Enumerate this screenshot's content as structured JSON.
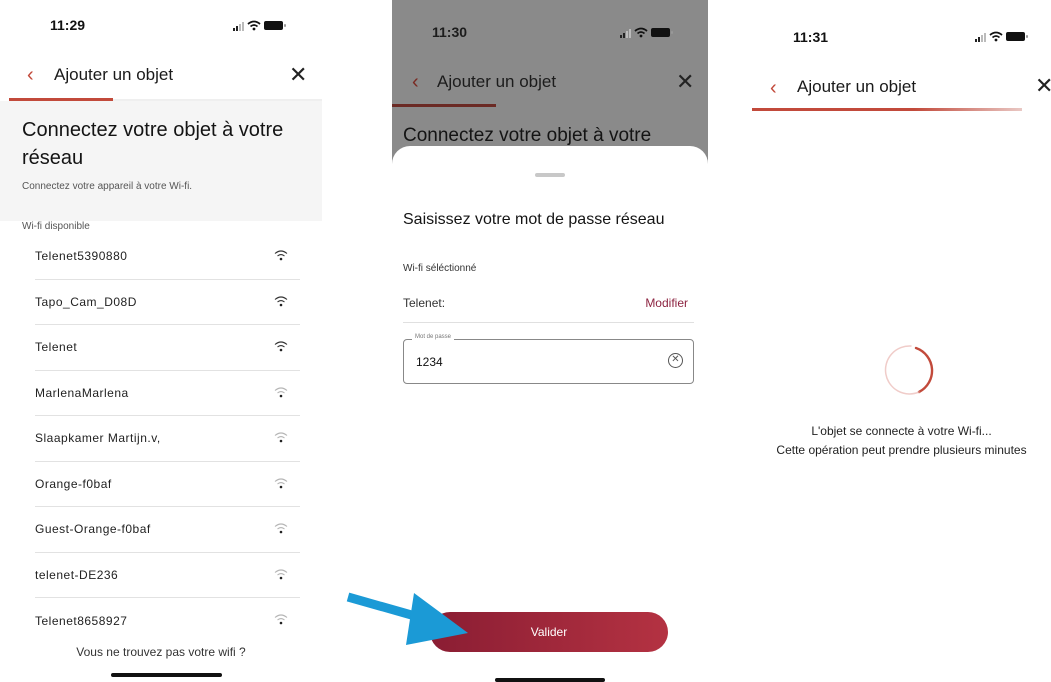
{
  "screen1": {
    "time": "11:29",
    "header_back": "‹",
    "header_title": "Ajouter un objet",
    "header_close": "✕",
    "heading_line1": "Connectez votre objet à votre",
    "heading_line2": "réseau",
    "subtitle": "Connectez votre appareil à votre Wi-fi.",
    "section_label": "Wi-fi disponible",
    "networks": [
      {
        "name": "Telenet5390880",
        "strength": "strong"
      },
      {
        "name": "Tapo_Cam_D08D",
        "strength": "strong"
      },
      {
        "name": "Telenet",
        "strength": "strong"
      },
      {
        "name": "MarlenaMarlena",
        "strength": "weak"
      },
      {
        "name": "Slaapkamer Martijn.v,",
        "strength": "weak"
      },
      {
        "name": "Orange-f0baf",
        "strength": "weak"
      },
      {
        "name": "Guest-Orange-f0baf",
        "strength": "weak"
      },
      {
        "name": "telenet-DE236",
        "strength": "weak"
      },
      {
        "name": "Telenet8658927",
        "strength": "weak"
      }
    ],
    "not_found": "Vous ne trouvez pas votre wifi ?"
  },
  "screen2": {
    "time": "11:30",
    "header_back": "‹",
    "header_title": "Ajouter un objet",
    "header_close": "✕",
    "behind_heading": "Connectez votre objet à votre",
    "sheet_title": "Saisissez votre mot de passe réseau",
    "selected_label": "Wi-fi séléctionné",
    "selected_network": "Telenet:",
    "modify_label": "Modifier",
    "password_legend": "Mot de passe",
    "password_value": "1234",
    "clear_icon": "✕",
    "submit_label": "Valider"
  },
  "screen3": {
    "time": "11:31",
    "header_back": "‹",
    "header_title": "Ajouter un objet",
    "header_close": "✕",
    "status_line1": "L'objet se connecte à votre Wi-fi...",
    "status_line2": "Cette opération peut prendre plusieurs minutes"
  },
  "colors": {
    "accent": "#c24a3b",
    "button": "#a02a3c",
    "arrow": "#1b9ad6",
    "link": "#8c2340"
  },
  "icons": [
    "chevron-left-icon",
    "close-icon",
    "wifi-icon",
    "clear-icon",
    "spinner-icon",
    "signal-icon",
    "battery-icon"
  ]
}
